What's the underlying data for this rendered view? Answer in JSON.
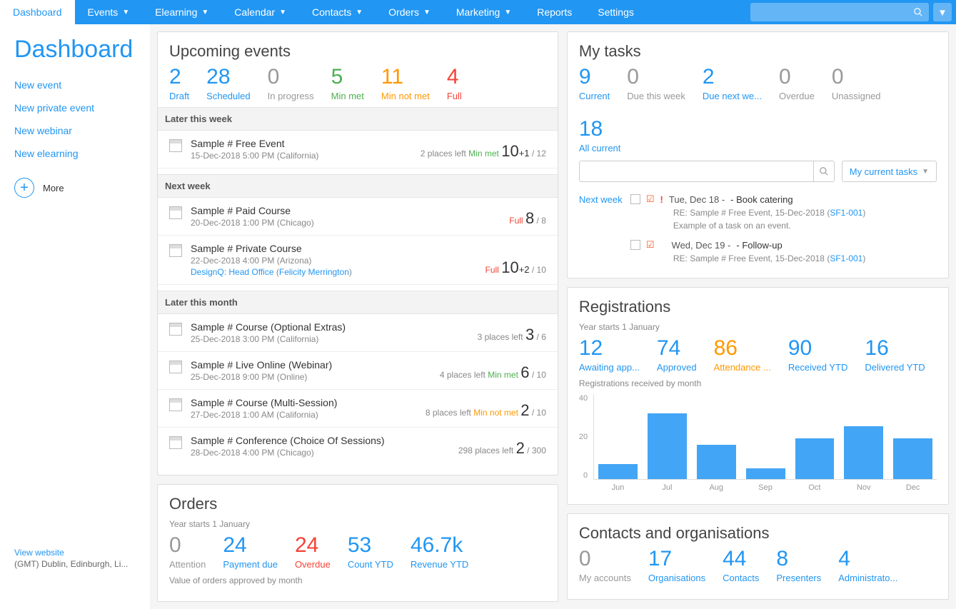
{
  "nav": {
    "items": [
      "Dashboard",
      "Events",
      "Elearning",
      "Calendar",
      "Contacts",
      "Orders",
      "Marketing",
      "Reports",
      "Settings"
    ],
    "has_caret": [
      false,
      true,
      true,
      true,
      true,
      true,
      true,
      false,
      false
    ],
    "active": 0
  },
  "sidebar": {
    "title": "Dashboard",
    "links": [
      "New event",
      "New private event",
      "New webinar",
      "New elearning"
    ],
    "more": "More",
    "view_website": "View website",
    "timezone": "(GMT) Dublin, Edinburgh, Li..."
  },
  "upcoming": {
    "heading": "Upcoming events",
    "stats": [
      {
        "num": "2",
        "lbl": "Draft",
        "color": "c-blue"
      },
      {
        "num": "28",
        "lbl": "Scheduled",
        "color": "c-blue"
      },
      {
        "num": "0",
        "lbl": "In progress",
        "color": "c-grey"
      },
      {
        "num": "5",
        "lbl": "Min met",
        "color": "c-green"
      },
      {
        "num": "11",
        "lbl": "Min not met",
        "color": "c-orange"
      },
      {
        "num": "4",
        "lbl": "Full",
        "color": "c-red"
      }
    ],
    "groups": [
      {
        "label": "Later this week",
        "events": [
          {
            "title": "Sample # Free Event",
            "meta": "15-Dec-2018 5:00 PM (California)",
            "right": {
              "places": "2 places left",
              "tag": "Min met",
              "tag_class": "tag-green",
              "big": "10",
              "extra": "+1",
              "total": "/ 12"
            }
          }
        ]
      },
      {
        "label": "Next week",
        "events": [
          {
            "title": "Sample # Paid Course",
            "meta": "20-Dec-2018 1:00 PM (Chicago)",
            "right": {
              "places": "",
              "tag": "Full",
              "tag_class": "tag-red",
              "big": "8",
              "extra": "",
              "total": "/ 8"
            }
          },
          {
            "title": "Sample # Private Course",
            "meta": "22-Dec-2018 4:00 PM (Arizona)",
            "link1": "DesignQ: Head Office",
            "link2": "Felicity Merrington",
            "right": {
              "places": "",
              "tag": "Full",
              "tag_class": "tag-red",
              "big": "10",
              "extra": "+2",
              "total": "/ 10"
            }
          }
        ]
      },
      {
        "label": "Later this month",
        "events": [
          {
            "title": "Sample # Course (Optional Extras)",
            "meta": "25-Dec-2018 3:00 PM (California)",
            "right": {
              "places": "3 places left",
              "tag": "",
              "tag_class": "",
              "big": "3",
              "extra": "",
              "total": "/ 6"
            }
          },
          {
            "title": "Sample # Live Online (Webinar)",
            "meta": "25-Dec-2018 9:00 PM (Online)",
            "right": {
              "places": "4 places left",
              "tag": "Min met",
              "tag_class": "tag-green",
              "big": "6",
              "extra": "",
              "total": "/ 10"
            }
          },
          {
            "title": "Sample # Course (Multi-Session)",
            "meta": "27-Dec-2018 1:00 AM (California)",
            "right": {
              "places": "8 places left",
              "tag": "Min not met",
              "tag_class": "tag-orange",
              "big": "2",
              "extra": "",
              "total": "/ 10"
            }
          },
          {
            "title": "Sample # Conference (Choice Of Sessions)",
            "meta": "28-Dec-2018 4:00 PM (Chicago)",
            "right": {
              "places": "298 places left",
              "tag": "",
              "tag_class": "",
              "big": "2",
              "extra": "",
              "total": "/ 300"
            }
          }
        ]
      }
    ]
  },
  "orders": {
    "heading": "Orders",
    "sub": "Year starts 1 January",
    "stats": [
      {
        "num": "0",
        "lbl": "Attention",
        "color": "c-grey"
      },
      {
        "num": "24",
        "lbl": "Payment due",
        "color": "c-blue"
      },
      {
        "num": "24",
        "lbl": "Overdue",
        "color": "c-red"
      },
      {
        "num": "53",
        "lbl": "Count YTD",
        "color": "c-blue"
      },
      {
        "num": "46.7k",
        "lbl": "Revenue YTD",
        "color": "c-blue"
      }
    ],
    "chart_title": "Value of orders approved by month"
  },
  "tasks": {
    "heading": "My tasks",
    "stats": [
      {
        "num": "9",
        "lbl": "Current",
        "color": "c-blue"
      },
      {
        "num": "0",
        "lbl": "Due this week",
        "color": "c-grey"
      },
      {
        "num": "2",
        "lbl": "Due next we...",
        "color": "c-blue"
      },
      {
        "num": "0",
        "lbl": "Overdue",
        "color": "c-grey"
      },
      {
        "num": "0",
        "lbl": "Unassigned",
        "color": "c-grey"
      },
      {
        "num": "18",
        "lbl": "All current",
        "color": "c-blue"
      }
    ],
    "filter_label": "My current tasks",
    "items": [
      {
        "week": "Next week",
        "warn": true,
        "date": "Tue, Dec 18 -",
        "title": "- Book catering",
        "sub_prefix": "RE: Sample # Free Event, 15-Dec-2018 (",
        "sub_link": "SF1-001",
        "sub_suffix": ")",
        "desc": "Example of a task on an event."
      },
      {
        "week": "",
        "warn": false,
        "date": "Wed, Dec 19 -",
        "title": "- Follow-up",
        "sub_prefix": "RE: Sample # Free Event, 15-Dec-2018 (",
        "sub_link": "SF1-001",
        "sub_suffix": ")",
        "desc": ""
      }
    ]
  },
  "registrations": {
    "heading": "Registrations",
    "sub": "Year starts 1 January",
    "stats": [
      {
        "num": "12",
        "lbl": "Awaiting app...",
        "color": "c-blue"
      },
      {
        "num": "74",
        "lbl": "Approved",
        "color": "c-blue"
      },
      {
        "num": "86",
        "lbl": "Attendance ...",
        "color": "c-orange"
      },
      {
        "num": "90",
        "lbl": "Received YTD",
        "color": "c-blue"
      },
      {
        "num": "16",
        "lbl": "Delivered YTD",
        "color": "c-blue"
      }
    ],
    "chart_title": "Registrations received by month"
  },
  "contacts": {
    "heading": "Contacts and organisations",
    "stats": [
      {
        "num": "0",
        "lbl": "My accounts",
        "color": "c-grey"
      },
      {
        "num": "17",
        "lbl": "Organisations",
        "color": "c-blue"
      },
      {
        "num": "44",
        "lbl": "Contacts",
        "color": "c-blue"
      },
      {
        "num": "8",
        "lbl": "Presenters",
        "color": "c-blue"
      },
      {
        "num": "4",
        "lbl": "Administrato...",
        "color": "c-blue"
      }
    ]
  },
  "chart_data": {
    "type": "bar",
    "categories": [
      "Jun",
      "Jul",
      "Aug",
      "Sep",
      "Oct",
      "Nov",
      "Dec"
    ],
    "values": [
      7,
      31,
      16,
      5,
      19,
      25,
      19
    ],
    "title": "Registrations received by month",
    "xlabel": "",
    "ylabel": "",
    "ylim": [
      0,
      40
    ],
    "ticks": [
      40,
      20,
      0
    ]
  }
}
